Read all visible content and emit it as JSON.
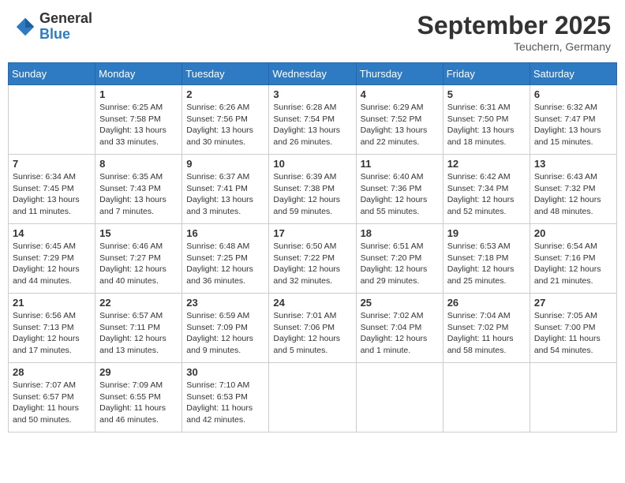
{
  "header": {
    "logo_general": "General",
    "logo_blue": "Blue",
    "month": "September 2025",
    "location": "Teuchern, Germany"
  },
  "weekdays": [
    "Sunday",
    "Monday",
    "Tuesday",
    "Wednesday",
    "Thursday",
    "Friday",
    "Saturday"
  ],
  "weeks": [
    [
      {
        "day": "",
        "info": ""
      },
      {
        "day": "1",
        "info": "Sunrise: 6:25 AM\nSunset: 7:58 PM\nDaylight: 13 hours\nand 33 minutes."
      },
      {
        "day": "2",
        "info": "Sunrise: 6:26 AM\nSunset: 7:56 PM\nDaylight: 13 hours\nand 30 minutes."
      },
      {
        "day": "3",
        "info": "Sunrise: 6:28 AM\nSunset: 7:54 PM\nDaylight: 13 hours\nand 26 minutes."
      },
      {
        "day": "4",
        "info": "Sunrise: 6:29 AM\nSunset: 7:52 PM\nDaylight: 13 hours\nand 22 minutes."
      },
      {
        "day": "5",
        "info": "Sunrise: 6:31 AM\nSunset: 7:50 PM\nDaylight: 13 hours\nand 18 minutes."
      },
      {
        "day": "6",
        "info": "Sunrise: 6:32 AM\nSunset: 7:47 PM\nDaylight: 13 hours\nand 15 minutes."
      }
    ],
    [
      {
        "day": "7",
        "info": "Sunrise: 6:34 AM\nSunset: 7:45 PM\nDaylight: 13 hours\nand 11 minutes."
      },
      {
        "day": "8",
        "info": "Sunrise: 6:35 AM\nSunset: 7:43 PM\nDaylight: 13 hours\nand 7 minutes."
      },
      {
        "day": "9",
        "info": "Sunrise: 6:37 AM\nSunset: 7:41 PM\nDaylight: 13 hours\nand 3 minutes."
      },
      {
        "day": "10",
        "info": "Sunrise: 6:39 AM\nSunset: 7:38 PM\nDaylight: 12 hours\nand 59 minutes."
      },
      {
        "day": "11",
        "info": "Sunrise: 6:40 AM\nSunset: 7:36 PM\nDaylight: 12 hours\nand 55 minutes."
      },
      {
        "day": "12",
        "info": "Sunrise: 6:42 AM\nSunset: 7:34 PM\nDaylight: 12 hours\nand 52 minutes."
      },
      {
        "day": "13",
        "info": "Sunrise: 6:43 AM\nSunset: 7:32 PM\nDaylight: 12 hours\nand 48 minutes."
      }
    ],
    [
      {
        "day": "14",
        "info": "Sunrise: 6:45 AM\nSunset: 7:29 PM\nDaylight: 12 hours\nand 44 minutes."
      },
      {
        "day": "15",
        "info": "Sunrise: 6:46 AM\nSunset: 7:27 PM\nDaylight: 12 hours\nand 40 minutes."
      },
      {
        "day": "16",
        "info": "Sunrise: 6:48 AM\nSunset: 7:25 PM\nDaylight: 12 hours\nand 36 minutes."
      },
      {
        "day": "17",
        "info": "Sunrise: 6:50 AM\nSunset: 7:22 PM\nDaylight: 12 hours\nand 32 minutes."
      },
      {
        "day": "18",
        "info": "Sunrise: 6:51 AM\nSunset: 7:20 PM\nDaylight: 12 hours\nand 29 minutes."
      },
      {
        "day": "19",
        "info": "Sunrise: 6:53 AM\nSunset: 7:18 PM\nDaylight: 12 hours\nand 25 minutes."
      },
      {
        "day": "20",
        "info": "Sunrise: 6:54 AM\nSunset: 7:16 PM\nDaylight: 12 hours\nand 21 minutes."
      }
    ],
    [
      {
        "day": "21",
        "info": "Sunrise: 6:56 AM\nSunset: 7:13 PM\nDaylight: 12 hours\nand 17 minutes."
      },
      {
        "day": "22",
        "info": "Sunrise: 6:57 AM\nSunset: 7:11 PM\nDaylight: 12 hours\nand 13 minutes."
      },
      {
        "day": "23",
        "info": "Sunrise: 6:59 AM\nSunset: 7:09 PM\nDaylight: 12 hours\nand 9 minutes."
      },
      {
        "day": "24",
        "info": "Sunrise: 7:01 AM\nSunset: 7:06 PM\nDaylight: 12 hours\nand 5 minutes."
      },
      {
        "day": "25",
        "info": "Sunrise: 7:02 AM\nSunset: 7:04 PM\nDaylight: 12 hours\nand 1 minute."
      },
      {
        "day": "26",
        "info": "Sunrise: 7:04 AM\nSunset: 7:02 PM\nDaylight: 11 hours\nand 58 minutes."
      },
      {
        "day": "27",
        "info": "Sunrise: 7:05 AM\nSunset: 7:00 PM\nDaylight: 11 hours\nand 54 minutes."
      }
    ],
    [
      {
        "day": "28",
        "info": "Sunrise: 7:07 AM\nSunset: 6:57 PM\nDaylight: 11 hours\nand 50 minutes."
      },
      {
        "day": "29",
        "info": "Sunrise: 7:09 AM\nSunset: 6:55 PM\nDaylight: 11 hours\nand 46 minutes."
      },
      {
        "day": "30",
        "info": "Sunrise: 7:10 AM\nSunset: 6:53 PM\nDaylight: 11 hours\nand 42 minutes."
      },
      {
        "day": "",
        "info": ""
      },
      {
        "day": "",
        "info": ""
      },
      {
        "day": "",
        "info": ""
      },
      {
        "day": "",
        "info": ""
      }
    ]
  ]
}
